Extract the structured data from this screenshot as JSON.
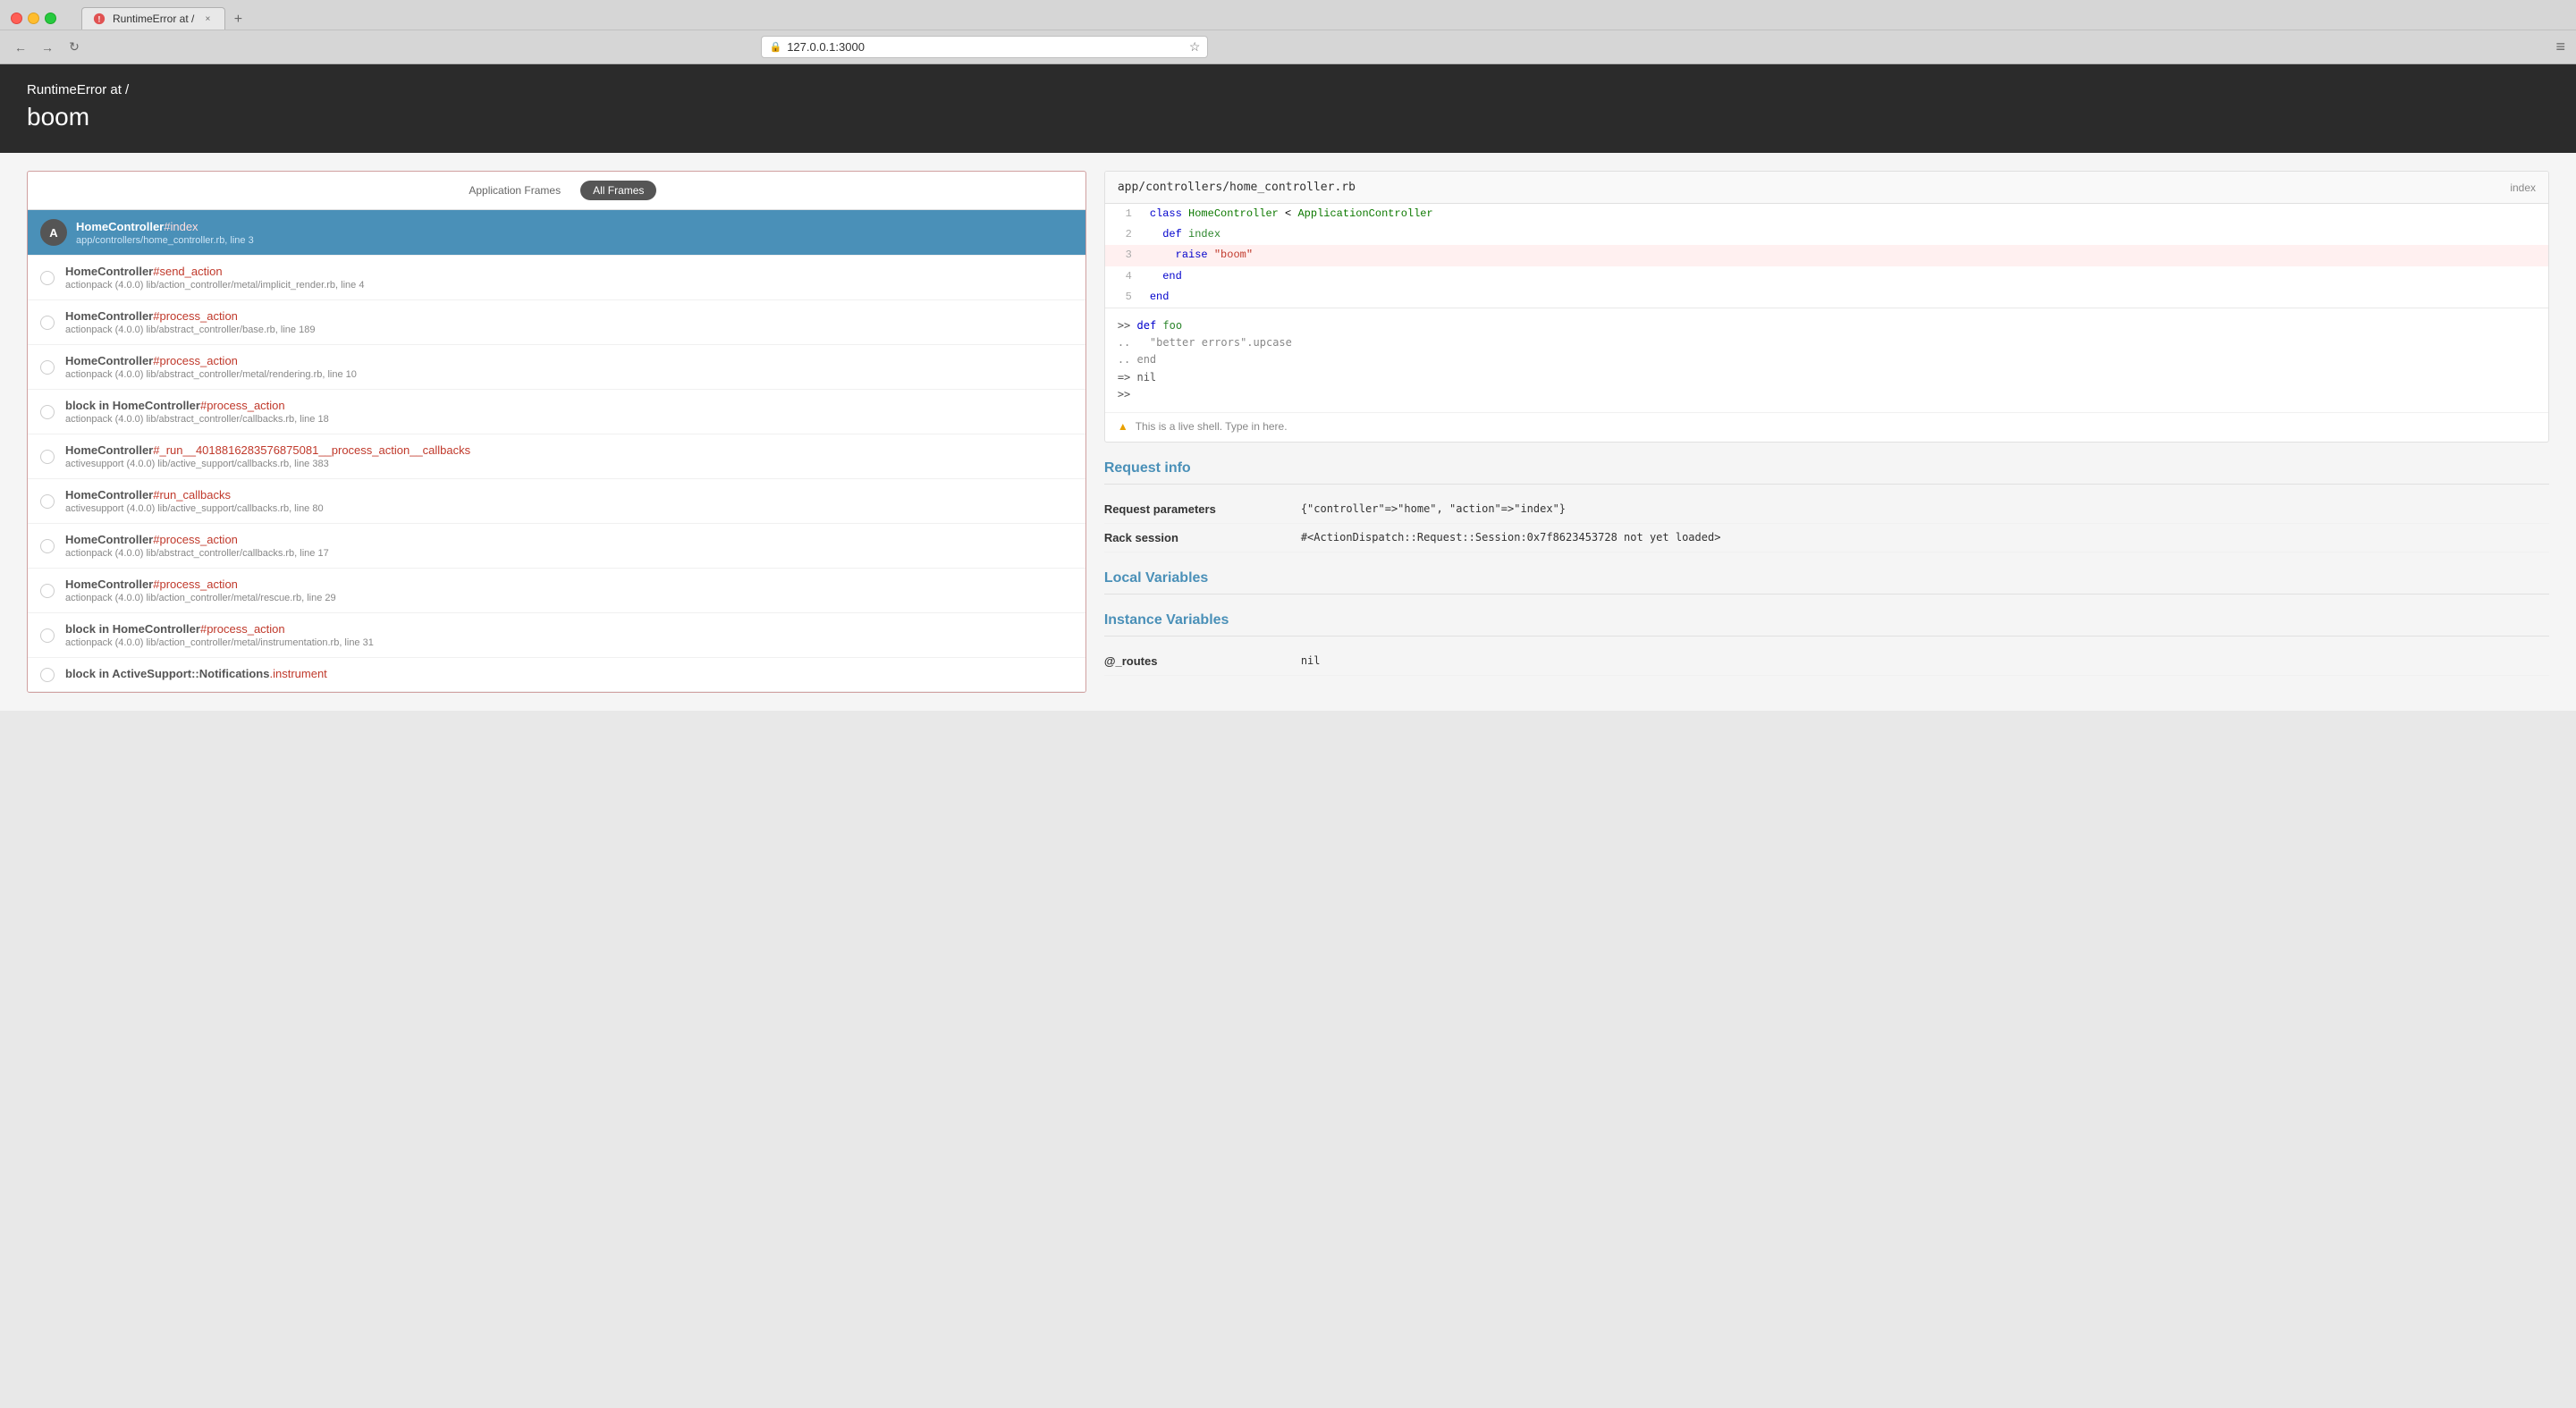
{
  "browser": {
    "tab_title": "RuntimeError at /",
    "url": "127.0.0.1:3000",
    "tab_close": "×"
  },
  "error": {
    "type": "RuntimeError",
    "at": " at /",
    "message": "boom"
  },
  "frames_panel": {
    "application_frames_label": "Application Frames",
    "all_frames_label": "All Frames",
    "frames": [
      {
        "id": 0,
        "avatar": "A",
        "selected": true,
        "controller": "HomeController",
        "method": "#index",
        "path": "app/controllers/home_controller.rb, line 3"
      },
      {
        "id": 1,
        "avatar": "",
        "selected": false,
        "controller": "HomeController",
        "method": "#send_action",
        "path": "actionpack (4.0.0) lib/action_controller/metal/implicit_render.rb, line 4"
      },
      {
        "id": 2,
        "avatar": "",
        "selected": false,
        "controller": "HomeController",
        "method": "#process_action",
        "path": "actionpack (4.0.0) lib/abstract_controller/base.rb, line 189"
      },
      {
        "id": 3,
        "avatar": "",
        "selected": false,
        "controller": "HomeController",
        "method": "#process_action",
        "path": "actionpack (4.0.0) lib/abstract_controller/metal/rendering.rb, line 10"
      },
      {
        "id": 4,
        "avatar": "",
        "selected": false,
        "controller": "block in HomeController",
        "method": "#process_action",
        "path": "actionpack (4.0.0) lib/abstract_controller/callbacks.rb, line 18"
      },
      {
        "id": 5,
        "avatar": "",
        "selected": false,
        "controller": "HomeController",
        "method": "#_run__4018816283576875081__process_action__callbacks",
        "path": "activesupport (4.0.0) lib/active_support/callbacks.rb, line 383"
      },
      {
        "id": 6,
        "avatar": "",
        "selected": false,
        "controller": "HomeController",
        "method": "#run_callbacks",
        "path": "activesupport (4.0.0) lib/active_support/callbacks.rb, line 80"
      },
      {
        "id": 7,
        "avatar": "",
        "selected": false,
        "controller": "HomeController",
        "method": "#process_action",
        "path": "actionpack (4.0.0) lib/abstract_controller/callbacks.rb, line 17"
      },
      {
        "id": 8,
        "avatar": "",
        "selected": false,
        "controller": "HomeController",
        "method": "#process_action",
        "path": "actionpack (4.0.0) lib/action_controller/metal/rescue.rb, line 29"
      },
      {
        "id": 9,
        "avatar": "",
        "selected": false,
        "controller": "block in HomeController",
        "method": "#process_action",
        "path": "actionpack (4.0.0) lib/action_controller/metal/instrumentation.rb, line 31"
      },
      {
        "id": 10,
        "avatar": "",
        "selected": false,
        "controller": "block in ActiveSupport::Notifications",
        "method": ".instrument",
        "path": ""
      }
    ]
  },
  "code_panel": {
    "filename": "app/controllers/home_controller.rb",
    "action_label": "index",
    "lines": [
      {
        "num": "1",
        "code": "class HomeController < ApplicationController",
        "highlighted": false
      },
      {
        "num": "2",
        "code": "  def index",
        "highlighted": false
      },
      {
        "num": "3",
        "code": "    raise \"boom\"",
        "highlighted": true
      },
      {
        "num": "4",
        "code": "  end",
        "highlighted": false
      },
      {
        "num": "5",
        "code": "end",
        "highlighted": false
      }
    ],
    "repl": {
      "lines": [
        {
          "type": "prompt",
          "text": ">> def foo"
        },
        {
          "type": "output",
          "text": "..   \"better errors\".upcase"
        },
        {
          "type": "output",
          "text": ".. end"
        },
        {
          "type": "result",
          "text": "=> nil"
        },
        {
          "type": "prompt",
          "text": ">>"
        }
      ]
    },
    "shell_hint": "This is a live shell. Type in here."
  },
  "request_info": {
    "title": "Request info",
    "parameters_label": "Request parameters",
    "parameters_value": "{\"controller\"=>\"home\", \"action\"=>\"index\"}",
    "session_label": "Rack session",
    "session_value": "#<ActionDispatch::Request::Session:0x7f8623453728 not yet loaded>"
  },
  "local_variables": {
    "title": "Local Variables"
  },
  "instance_variables": {
    "title": "Instance Variables",
    "routes_label": "@_routes",
    "routes_value": "nil"
  }
}
